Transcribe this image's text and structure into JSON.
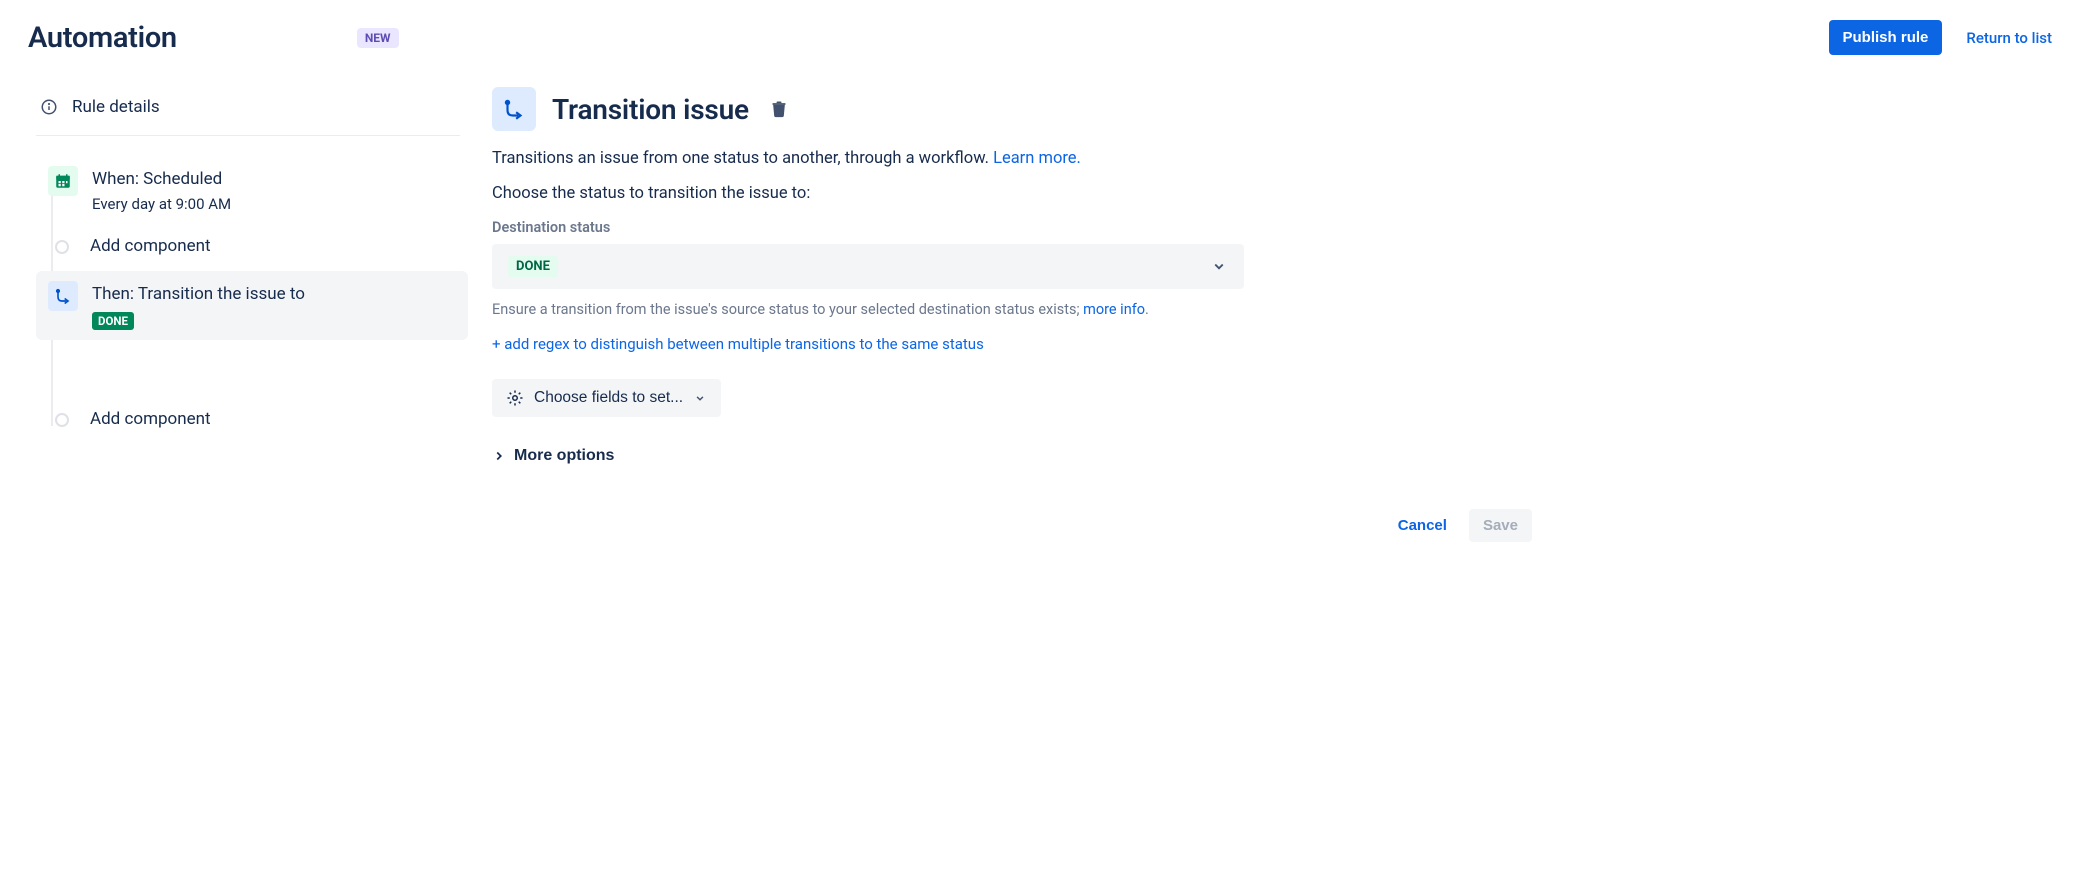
{
  "header": {
    "title": "Automation",
    "new_badge": "NEW",
    "publish_label": "Publish rule",
    "return_label": "Return to list"
  },
  "sidebar": {
    "rule_details_label": "Rule details",
    "steps": {
      "trigger": {
        "title": "When: Scheduled",
        "sub": "Every day at 9:00 AM"
      },
      "add1": {
        "title": "Add component"
      },
      "action": {
        "title": "Then: Transition the issue to",
        "status_lozenge": "DONE"
      },
      "add2": {
        "title": "Add component"
      }
    }
  },
  "panel": {
    "title": "Transition issue",
    "description_text": "Transitions an issue from one status to another, through a workflow. ",
    "learn_more": "Learn more.",
    "choose_label": "Choose the status to transition the issue to:",
    "dest_label": "Destination status",
    "dest_value": "DONE",
    "helper_text": "Ensure a transition from the issue's source status to your selected destination status exists; ",
    "more_info": "more info",
    "helper_period": ".",
    "add_regex": "+ add regex to distinguish between multiple transitions to the same status",
    "choose_fields": "Choose fields to set...",
    "more_options": "More options"
  },
  "footer": {
    "cancel": "Cancel",
    "save": "Save"
  }
}
